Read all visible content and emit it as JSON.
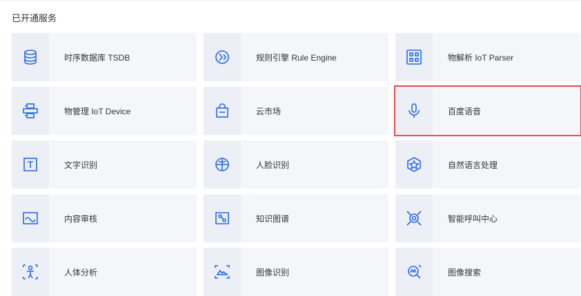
{
  "section": {
    "title": "已开通服务"
  },
  "services": [
    {
      "label": "时序数据库 TSDB",
      "icon": "database-icon"
    },
    {
      "label": "规则引擎 Rule Engine",
      "icon": "rule-engine-icon"
    },
    {
      "label": "物解析 IoT Parser",
      "icon": "parser-icon"
    },
    {
      "label": "物管理 IoT Device",
      "icon": "device-management-icon"
    },
    {
      "label": "云市场",
      "icon": "shopping-bag-icon"
    },
    {
      "label": "百度语音",
      "icon": "microphone-icon"
    },
    {
      "label": "文字识别",
      "icon": "text-recognition-icon"
    },
    {
      "label": "人脸识别",
      "icon": "face-recognition-icon"
    },
    {
      "label": "自然语言处理",
      "icon": "nlp-icon"
    },
    {
      "label": "内容审核",
      "icon": "content-review-icon"
    },
    {
      "label": "知识图谱",
      "icon": "knowledge-graph-icon"
    },
    {
      "label": "智能呼叫中心",
      "icon": "call-center-icon"
    },
    {
      "label": "人体分析",
      "icon": "body-analysis-icon"
    },
    {
      "label": "图像识别",
      "icon": "image-recognition-icon"
    },
    {
      "label": "图像搜索",
      "icon": "image-search-icon"
    }
  ],
  "colors": {
    "icon": "#2468f2",
    "highlight": "#e24c4c",
    "card": "#f5f6fa"
  }
}
